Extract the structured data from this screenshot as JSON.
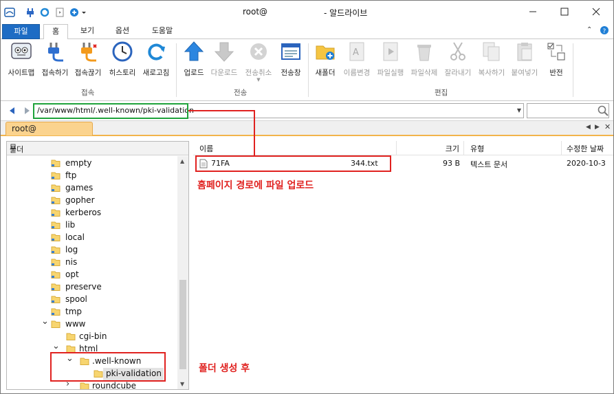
{
  "window": {
    "title": "root@",
    "app_name": "- 알드라이브"
  },
  "ribbon_tabs": [
    "파일",
    "홈",
    "보기",
    "옵션",
    "도움말"
  ],
  "ribbon": {
    "connect_group": {
      "label": "접속",
      "buttons": [
        "사이트맵",
        "접속하기",
        "접속끊기",
        "히스토리",
        "새로고침"
      ]
    },
    "transfer_group": {
      "label": "전송",
      "buttons": [
        "업로드",
        "다운로드",
        "전송취소",
        "전송창"
      ]
    },
    "edit_group": {
      "label": "편집",
      "buttons": [
        "새폴더",
        "이름변경",
        "파일실행",
        "파일삭제",
        "잘라내기",
        "복사하기",
        "붙여넣기",
        "반전"
      ]
    }
  },
  "address": {
    "path": "/var/www/html/.well-known/pki-validation",
    "search_placeholder": ""
  },
  "session_tab": "root@",
  "tree": {
    "header": "폴더",
    "items": [
      {
        "name": "empty"
      },
      {
        "name": "ftp"
      },
      {
        "name": "games"
      },
      {
        "name": "gopher"
      },
      {
        "name": "kerberos"
      },
      {
        "name": "lib"
      },
      {
        "name": "local"
      },
      {
        "name": "log"
      },
      {
        "name": "nis"
      },
      {
        "name": "opt"
      },
      {
        "name": "preserve"
      },
      {
        "name": "spool"
      },
      {
        "name": "tmp"
      },
      {
        "name": "www",
        "expanded": true
      },
      {
        "name": "cgi-bin"
      },
      {
        "name": "html",
        "expanded": true
      },
      {
        "name": ".well-known",
        "expanded": true
      },
      {
        "name": "pki-validation",
        "selected": true
      },
      {
        "name": "roundcube"
      }
    ]
  },
  "file_list": {
    "columns": [
      "이름",
      "크기",
      "유형",
      "수정한 날짜"
    ],
    "rows": [
      {
        "name": "71FA",
        "name_suffix": "344.txt",
        "size": "93 B",
        "type": "텍스트 문서",
        "modified": "2020-10-3"
      }
    ]
  },
  "annotations": {
    "upload_note": "홈페이지 경로에 파일 업로드",
    "folder_note": "폴더 생성 후"
  },
  "colors": {
    "accent": "#1e6cc4",
    "session_tab": "#fbd38e",
    "annotation_red": "#e0211f",
    "annotation_green": "#1ea23a"
  }
}
